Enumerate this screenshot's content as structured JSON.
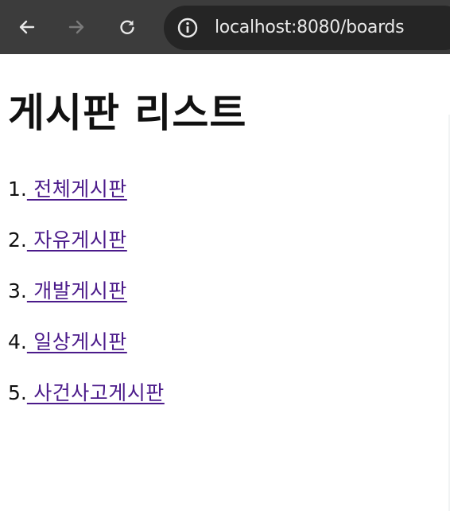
{
  "browser": {
    "url": "localhost:8080/boards",
    "icons": {
      "back": "arrow-left-icon",
      "forward": "arrow-right-icon",
      "reload": "reload-icon",
      "site_info": "info-icon"
    },
    "colors": {
      "toolbar": "#3c3c3c",
      "omnibox": "#252525",
      "url_text": "#e8e8e8"
    }
  },
  "page": {
    "title": "게시판 리스트",
    "boards": [
      {
        "number": "1.",
        "label": " 전체게시판"
      },
      {
        "number": "2.",
        "label": " 자유게시판"
      },
      {
        "number": "3.",
        "label": " 개발게시판"
      },
      {
        "number": "4.",
        "label": " 일상게시판"
      },
      {
        "number": "5.",
        "label": " 사건사고게시판"
      }
    ],
    "colors": {
      "link": "#4b1a8a",
      "text": "#111111"
    }
  }
}
